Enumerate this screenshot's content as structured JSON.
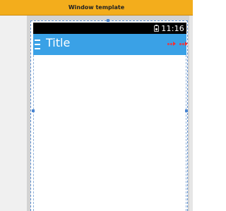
{
  "window": {
    "title": "Window template"
  },
  "statusbar": {
    "battery_icon": "battery-icon",
    "time": "11:16"
  },
  "actionbar": {
    "menu_icon": "hamburger-menu-icon",
    "title": "Title",
    "action_icons": [
      "action-item-icon",
      "action-item-icon"
    ]
  },
  "colors": {
    "titlebar": "#f3ad1c",
    "statusbar": "#000000",
    "actionbar": "#3aa1e6",
    "action_markers": "#ff2a2a",
    "selection": "#5d8fd1"
  }
}
